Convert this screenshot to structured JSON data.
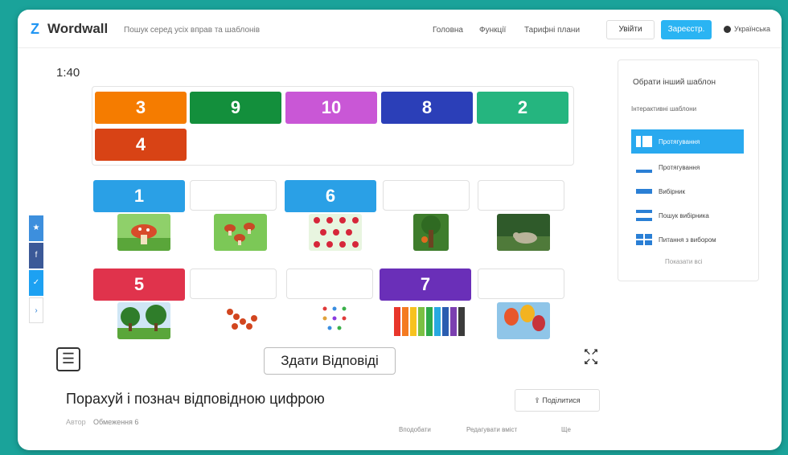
{
  "header": {
    "logo_text": "Wordwall",
    "search_placeholder": "Пошук серед усіх вправ та шаблонів",
    "nav": [
      "Головна",
      "Функції",
      "Тарифні плани"
    ],
    "login_label": "Увійти",
    "signup_label": "Зареєстр.",
    "language_label": "Українська"
  },
  "activity": {
    "timer": "1:40",
    "bank_tiles": [
      {
        "label": "3",
        "color": "#f57c00"
      },
      {
        "label": "9",
        "color": "#138f3c"
      },
      {
        "label": "10",
        "color": "#c957d6"
      },
      {
        "label": "8",
        "color": "#2b3fb8"
      },
      {
        "label": "2",
        "color": "#25b57f"
      },
      {
        "label": "4",
        "color": "#d84315"
      }
    ],
    "placed_tiles": [
      {
        "label": "1",
        "color": "#2aa0e6"
      },
      {
        "label": "6",
        "color": "#2aa0e6"
      },
      {
        "label": "5",
        "color": "#e0334c"
      },
      {
        "label": "7",
        "color": "#6a2fb8"
      }
    ],
    "pictures": [
      "mushroom",
      "mushrooms",
      "berries",
      "fox-tree",
      "forest-animal",
      "trees",
      "rowan-berries",
      "dots",
      "pencils",
      "balloons"
    ],
    "submit_label": "Здати Відповіді",
    "title": "Порахуй і познач відповідною цифрою",
    "author_label": "Автор",
    "author_name": "Обмеження 6",
    "share_label": "Поділитися",
    "footer_links": [
      "Вподобати",
      "Редагувати вміст",
      "Ще"
    ]
  },
  "panel": {
    "title": "Обрати інший шаблон",
    "subtitle": "Інтерактивні шаблони",
    "templates": [
      "Протягування",
      "Протягування",
      "Вибірник",
      "Пошук вибірника",
      "Питання з вибором"
    ],
    "show_all": "Показати всі"
  },
  "share_colors": [
    "#4267b2",
    "#365899",
    "#1da1f2",
    "#ffffff"
  ]
}
